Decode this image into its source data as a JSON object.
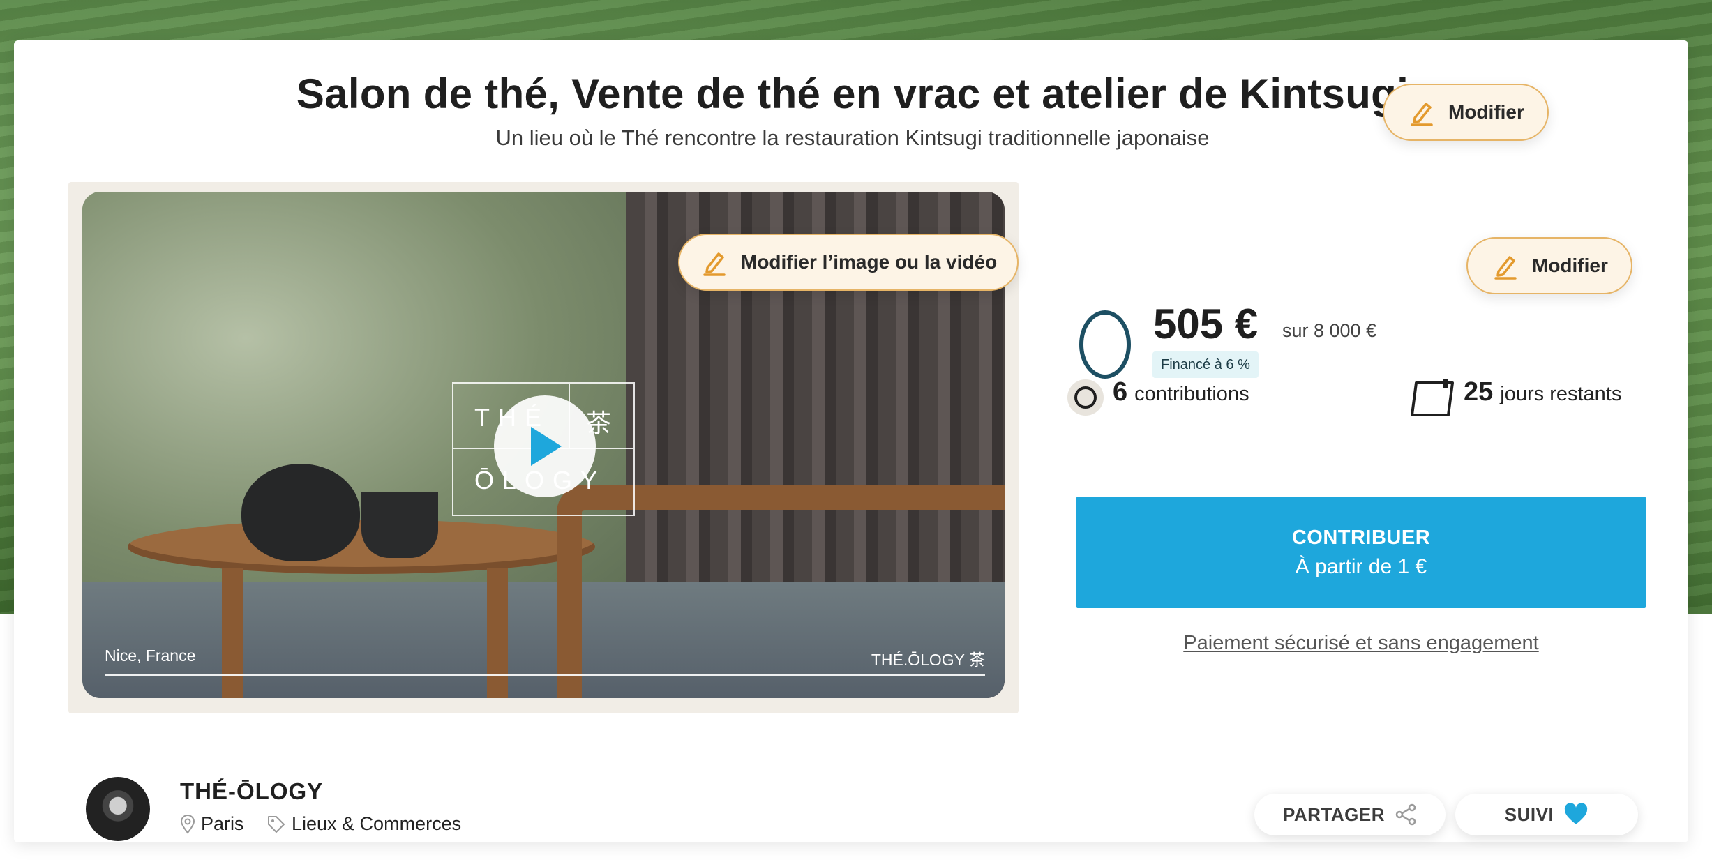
{
  "project": {
    "title": "Salon de thé, Vente de thé en vrac et atelier de Kintsugi",
    "subtitle": "Un lieu où le Thé rencontre la restauration Kintsugi traditionnelle japonaise"
  },
  "edit": {
    "title_label": "Modifier",
    "media_label": "Modifier l’image ou la vidéo",
    "funding_label": "Modifier"
  },
  "media": {
    "logo_top_left": "THÉ",
    "logo_top_right": "茶",
    "logo_bottom": "ŌLOGY",
    "caption_left": "Nice, France",
    "caption_right": "THÉ.ŌLOGY 茶"
  },
  "funding": {
    "amount": "505 €",
    "goal": "sur 8 000 €",
    "funded_label": "Financé à 6 %",
    "funded_percent": 6,
    "contributions_count": "6",
    "contributions_label": "contributions",
    "days_count": "25",
    "days_label": "jours restants"
  },
  "cta": {
    "line1": "CONTRIBUER",
    "line2": "À partir de 1 €",
    "secure_link": "Paiement sécurisé et sans engagement"
  },
  "owner": {
    "name": "THÉ-ŌLOGY",
    "location": "Paris",
    "category": "Lieux & Commerces"
  },
  "actions": {
    "share_label": "PARTAGER",
    "follow_label": "SUIVI"
  },
  "colors": {
    "accent_blue": "#1ea7dc",
    "edit_border": "#e6b466",
    "edit_bg": "#fdf4e6",
    "ring": "#1d4f63",
    "badge_bg": "#e3f4f7"
  }
}
